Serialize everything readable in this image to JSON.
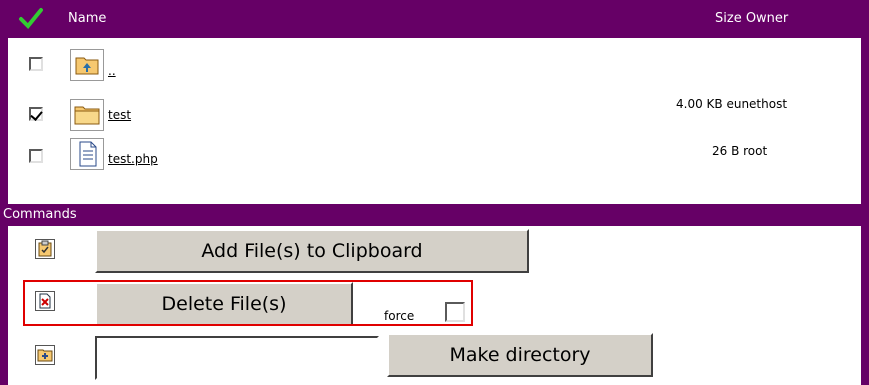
{
  "header": {
    "name_label": "Name",
    "size_owner_label": "Size Owner"
  },
  "files": [
    {
      "name": "..",
      "size_owner": "",
      "checked": false,
      "icon": "folder-up-icon"
    },
    {
      "name": "test",
      "size_owner": "4.00 KB eunethost",
      "checked": true,
      "icon": "folder-icon"
    },
    {
      "name": "test.php",
      "size_owner": "26 B root",
      "checked": false,
      "icon": "document-icon"
    }
  ],
  "commands": {
    "title": "Commands",
    "clipboard_label": "Add File(s) to Clipboard",
    "delete_label": "Delete File(s)",
    "force_label": "force",
    "mkdir_label": "Make directory",
    "mkdir_value": ""
  },
  "colors": {
    "frame": "#660066",
    "highlight": "#e00000",
    "button": "#d4d0c8"
  }
}
